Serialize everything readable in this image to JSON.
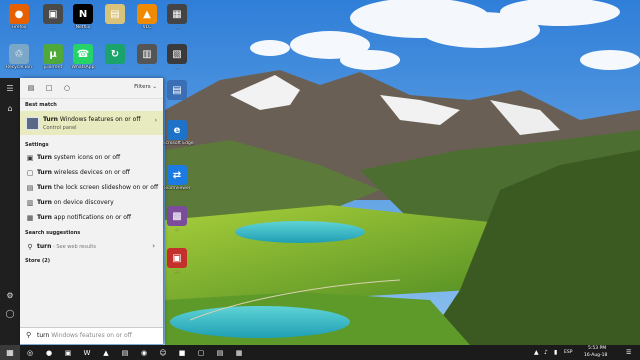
{
  "desktop": {
    "icons": [
      {
        "label": "Firefox",
        "glyph": "●",
        "color": "#e66000"
      },
      {
        "label": "...",
        "glyph": "▣",
        "color": "#4a4a4a"
      },
      {
        "label": "Netflix",
        "glyph": "N",
        "color": "#000000"
      },
      {
        "label": "...",
        "glyph": "▤",
        "color": "#d9c27a"
      },
      {
        "label": "VLC",
        "glyph": "▲",
        "color": "#f08a00"
      },
      {
        "label": "...",
        "glyph": "▦",
        "color": "#444444"
      },
      {
        "label": "Recycle Bin",
        "glyph": "♲",
        "color": "#7aa7c7"
      },
      {
        "label": "µTorrent",
        "glyph": "µ",
        "color": "#4ea83a"
      },
      {
        "label": "WhatsApp",
        "glyph": "☎",
        "color": "#25d366"
      },
      {
        "label": "...",
        "glyph": "↻",
        "color": "#1aa36b"
      },
      {
        "label": "...",
        "glyph": "▥",
        "color": "#555555"
      },
      {
        "label": "...",
        "glyph": "▧",
        "color": "#3a3a3a"
      }
    ],
    "right_column": [
      {
        "label": "",
        "glyph": "▤",
        "color": "#3b6fb5"
      },
      {
        "label": "Microsoft Edge",
        "glyph": "e",
        "color": "#1e73c8"
      },
      {
        "label": "TeamViewer",
        "glyph": "⇄",
        "color": "#1b7be3"
      },
      {
        "label": "...",
        "glyph": "▩",
        "color": "#7b4b9c"
      },
      {
        "label": "...",
        "glyph": "▣",
        "color": "#c4302b"
      }
    ]
  },
  "panel": {
    "filters_label": "Filters",
    "best_match_header": "Best match",
    "best_match": {
      "bold": "Turn",
      "rest": " Windows features on or off",
      "sub": "Control panel"
    },
    "settings_header": "Settings",
    "settings": [
      {
        "bold": "Turn",
        "rest": " system icons on or off"
      },
      {
        "bold": "Turn",
        "rest": " wireless devices on or off"
      },
      {
        "bold": "Turn",
        "rest": " the lock screen slideshow on or off"
      },
      {
        "bold": "Turn",
        "rest": " on device discovery"
      },
      {
        "bold": "Turn",
        "rest": " app notifications on or off"
      }
    ],
    "suggestions_header": "Search suggestions",
    "suggestion": {
      "bold": "turn",
      "muted": " - See web results"
    },
    "store_header": "Store (2)"
  },
  "search": {
    "typed": "turn",
    "ghost": " Windows features on or off"
  },
  "taskbar": {
    "apps": [
      "◎",
      "●",
      "▣",
      "W",
      "▲",
      "▤",
      "◉",
      "☺",
      "■",
      "▢",
      "▤",
      "▦"
    ],
    "lang": "ESP",
    "time": "5:53 PM",
    "date": "16-Aug-18"
  },
  "colors": {
    "accent": "#e8eac0",
    "panel_bg": "#f2f2f2",
    "rail_bg": "#1f1f1f",
    "taskbar_bg": "#1b1b1b"
  }
}
